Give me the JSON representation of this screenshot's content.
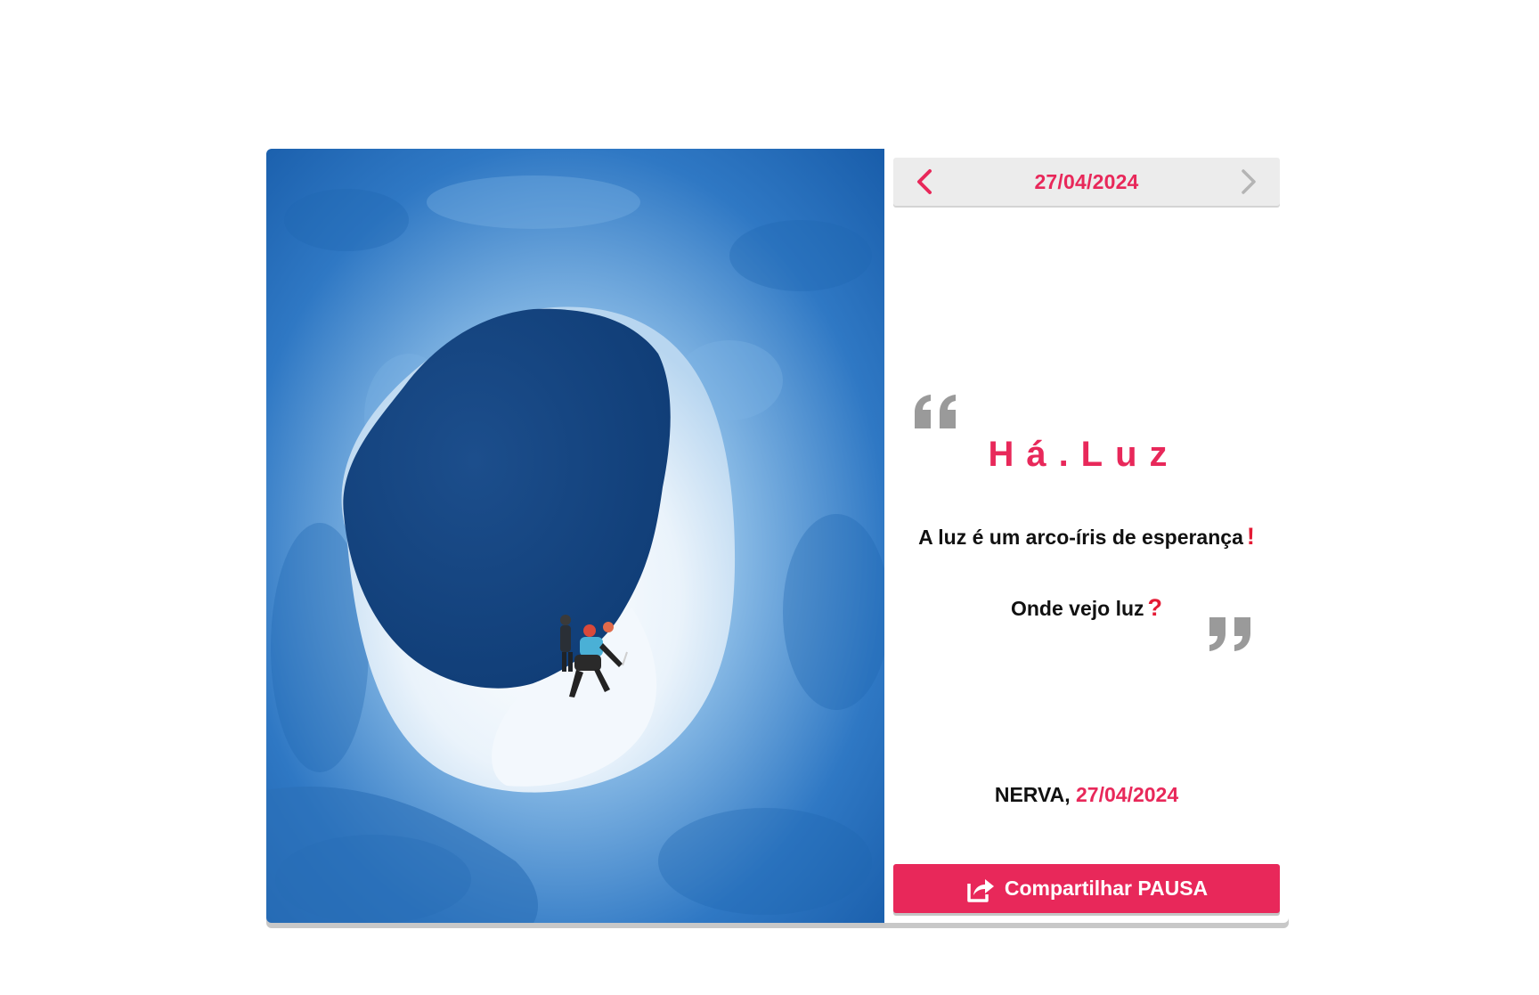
{
  "nav": {
    "date": "27/04/2024",
    "prev_icon": "chevron-left-icon",
    "next_icon": "chevron-right-icon"
  },
  "photo": {
    "subject": "ice-cave-climbers"
  },
  "quote": {
    "title": "Há.Luz",
    "line1": "A luz é um arco-íris de esperança",
    "line1_mark": "!",
    "line2": "Onde vejo luz",
    "line2_mark": "?",
    "open_icon": "quote-open-icon",
    "close_icon": "quote-close-icon"
  },
  "signature": {
    "author": "NERVA,",
    "date": "27/04/2024"
  },
  "share": {
    "label": "Compartilhar PAUSA",
    "icon": "share-icon"
  },
  "colors": {
    "accent": "#e8285a",
    "mark": "#e41b35",
    "quote_icon": "#9a9a9a",
    "datebar_bg": "#ececec"
  }
}
